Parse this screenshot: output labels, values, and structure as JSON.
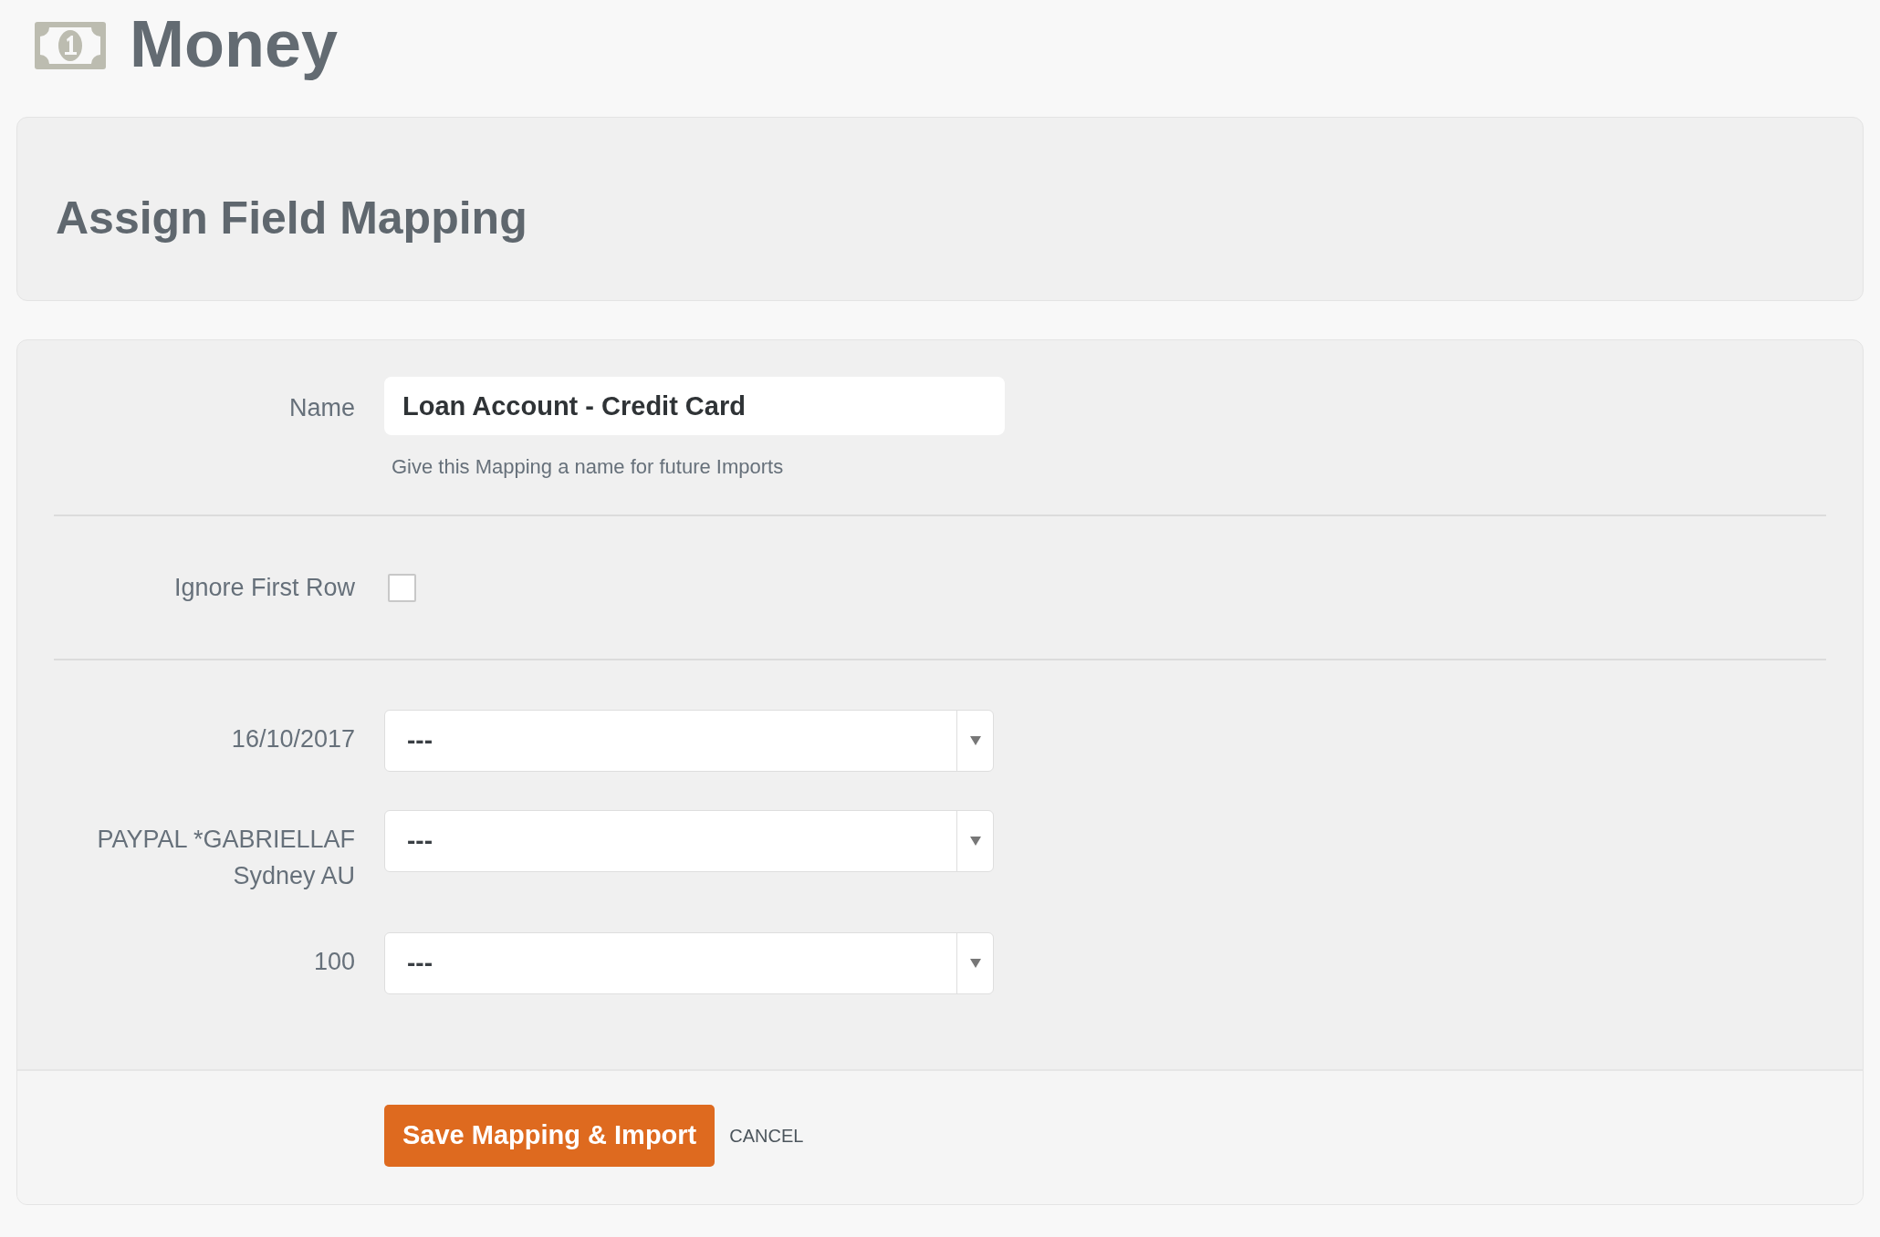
{
  "header": {
    "title": "Money"
  },
  "page_title": "Assign Field Mapping",
  "form": {
    "name_field": {
      "label": "Name",
      "value": "Loan Account - Credit Card",
      "help": "Give this Mapping a name for future Imports"
    },
    "ignore_first_row": {
      "label": "Ignore First Row",
      "checked": false
    },
    "mappings": [
      {
        "label": "16/10/2017",
        "value": "---"
      },
      {
        "label": "PAYPAL *GABRIELLAF Sydney AU",
        "value": "---"
      },
      {
        "label": "100",
        "value": "---"
      }
    ]
  },
  "actions": {
    "primary": "Save Mapping & Import",
    "cancel": "CANCEL"
  }
}
